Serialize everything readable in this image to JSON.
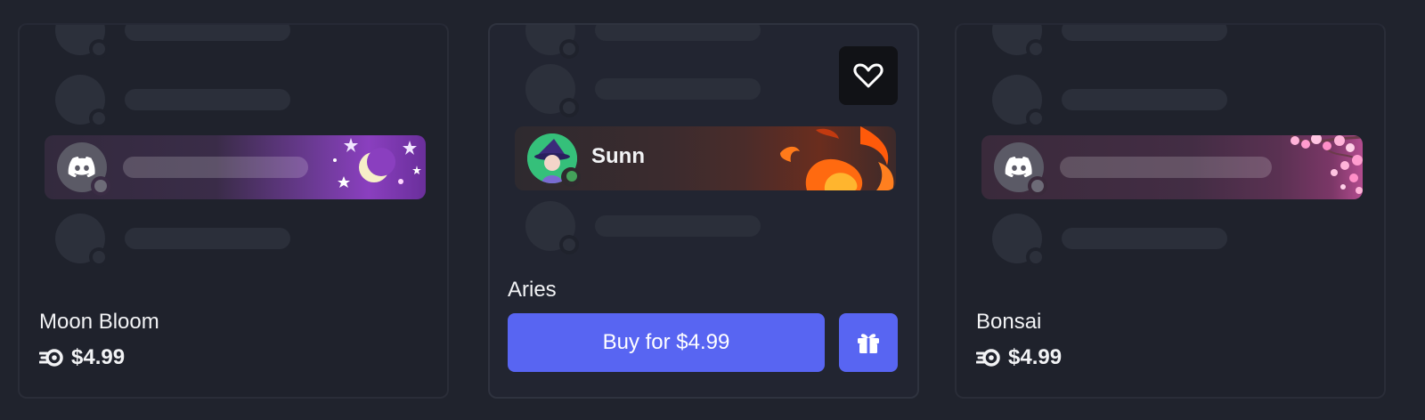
{
  "cards": [
    {
      "name": "Moon Bloom",
      "price": "$4.99",
      "price_icon": "orb-icon",
      "accent": "#8a3fbf"
    },
    {
      "name": "Aries",
      "preview_user": "Sunn",
      "buy_label": "Buy for $4.99",
      "heart_icon": "heart-icon",
      "gift_icon": "gift-icon",
      "accent": "#5865f2"
    },
    {
      "name": "Bonsai",
      "price": "$4.99",
      "price_icon": "orb-icon",
      "accent": "#b34c8f"
    }
  ]
}
